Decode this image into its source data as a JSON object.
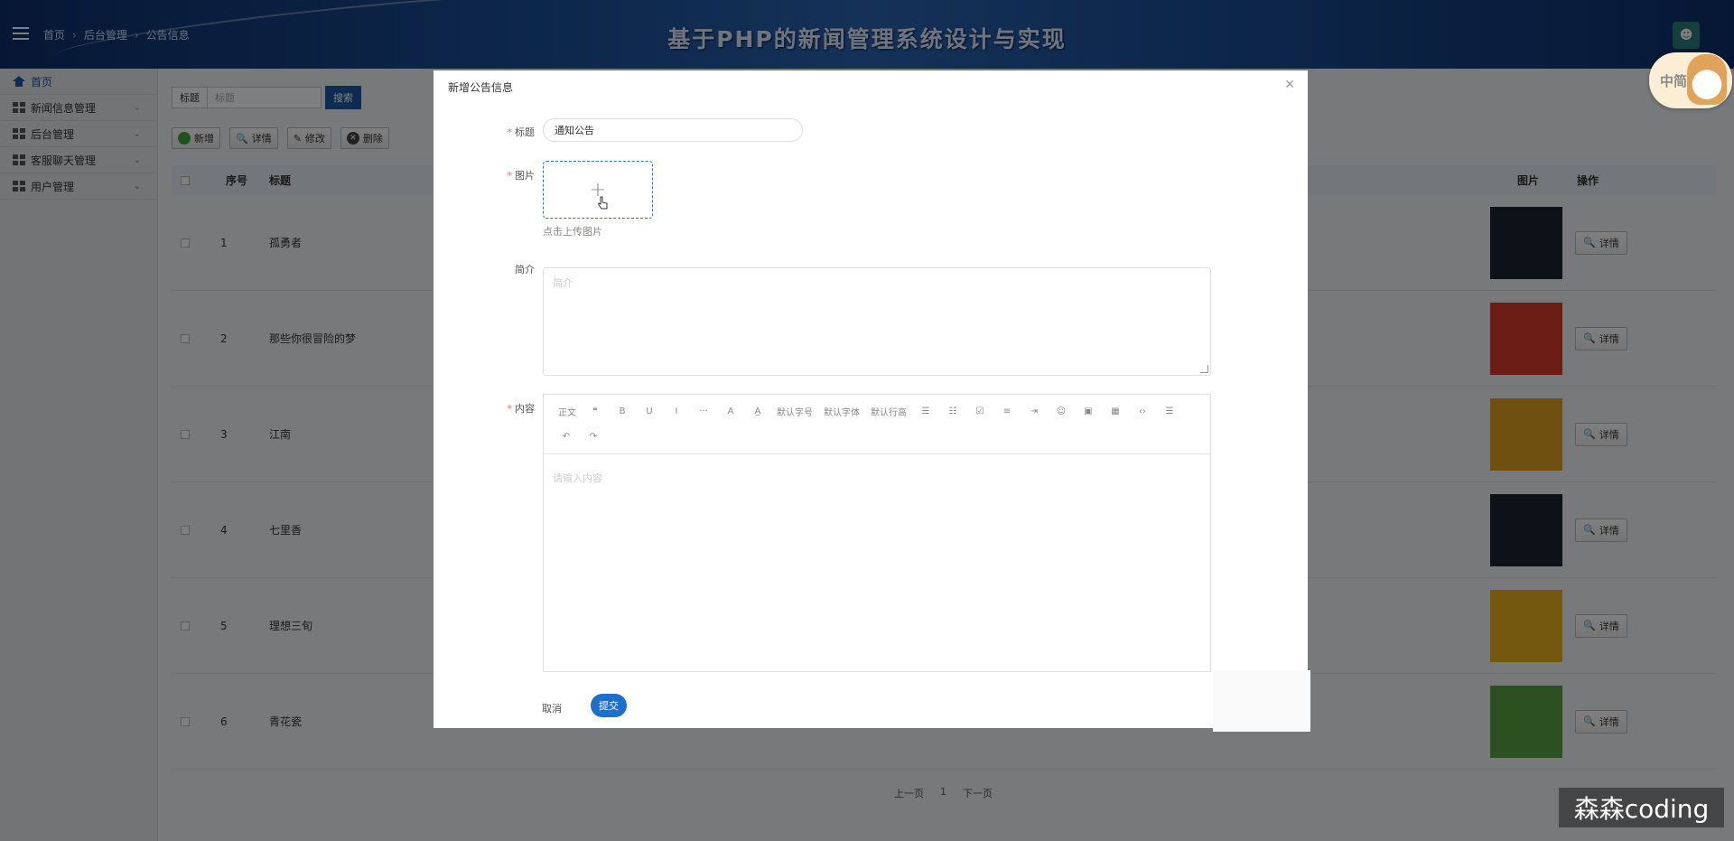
{
  "header": {
    "breadcrumb": [
      "首页",
      "后台管理",
      "公告信息"
    ],
    "site_title": "基于PHP的新闻管理系统设计与实现",
    "mascot_text": "中简"
  },
  "sidebar": {
    "items": [
      {
        "label": "首页",
        "icon": "home-icon"
      },
      {
        "label": "新闻信息管理",
        "icon": "grid-icon"
      },
      {
        "label": "后台管理",
        "icon": "grid-icon"
      },
      {
        "label": "客服聊天管理",
        "icon": "grid-icon"
      },
      {
        "label": "用户管理",
        "icon": "grid-icon"
      }
    ]
  },
  "search": {
    "label": "标题",
    "placeholder": "标题",
    "button": "搜索"
  },
  "toolbar": {
    "add": "新增",
    "detail": "详情",
    "edit": "修改",
    "delete": "删除"
  },
  "table": {
    "headers": {
      "no": "序号",
      "title": "标题",
      "image": "图片",
      "action": "操作"
    },
    "rows": [
      {
        "no": "1",
        "title": "孤勇者",
        "action": "详情",
        "thumb_color": "#1b2230"
      },
      {
        "no": "2",
        "title": "那些你很冒险的梦",
        "action": "详情",
        "thumb_color": "#d73a2a"
      },
      {
        "no": "3",
        "title": "江南",
        "action": "详情",
        "thumb_color": "#e0a020"
      },
      {
        "no": "4",
        "title": "七里香",
        "action": "详情",
        "thumb_color": "#1b2230"
      },
      {
        "no": "5",
        "title": "理想三旬",
        "action": "详情",
        "thumb_color": "#e8b020"
      },
      {
        "no": "6",
        "title": "青花瓷",
        "action": "详情",
        "thumb_color": "#5aa040"
      }
    ]
  },
  "pager": {
    "prev": "上一页",
    "page": "1",
    "next": "下一页"
  },
  "dialog": {
    "title": "新增公告信息",
    "fields": {
      "title_label": "标题",
      "title_value": "通知公告",
      "image_label": "图片",
      "upload_tip": "点击上传图片",
      "intro_label": "简介",
      "intro_placeholder": "简介",
      "content_label": "内容",
      "content_placeholder": "请输入内容"
    },
    "editor_tools": [
      "正文",
      "❝",
      "B",
      "U",
      "I",
      "···",
      "A",
      "A̲",
      "默认字号",
      "默认字体",
      "默认行高",
      "☰",
      "☷",
      "☑",
      "≡",
      "⇥",
      "☺",
      "▣",
      "▦",
      "‹›",
      "☰",
      "↶",
      "↷"
    ],
    "cancel": "取消",
    "submit": "提交"
  },
  "watermark": "森森coding",
  "colors": {
    "primary": "#1d58a5",
    "submit": "#1d6fcb",
    "required": "#f56c6c"
  }
}
